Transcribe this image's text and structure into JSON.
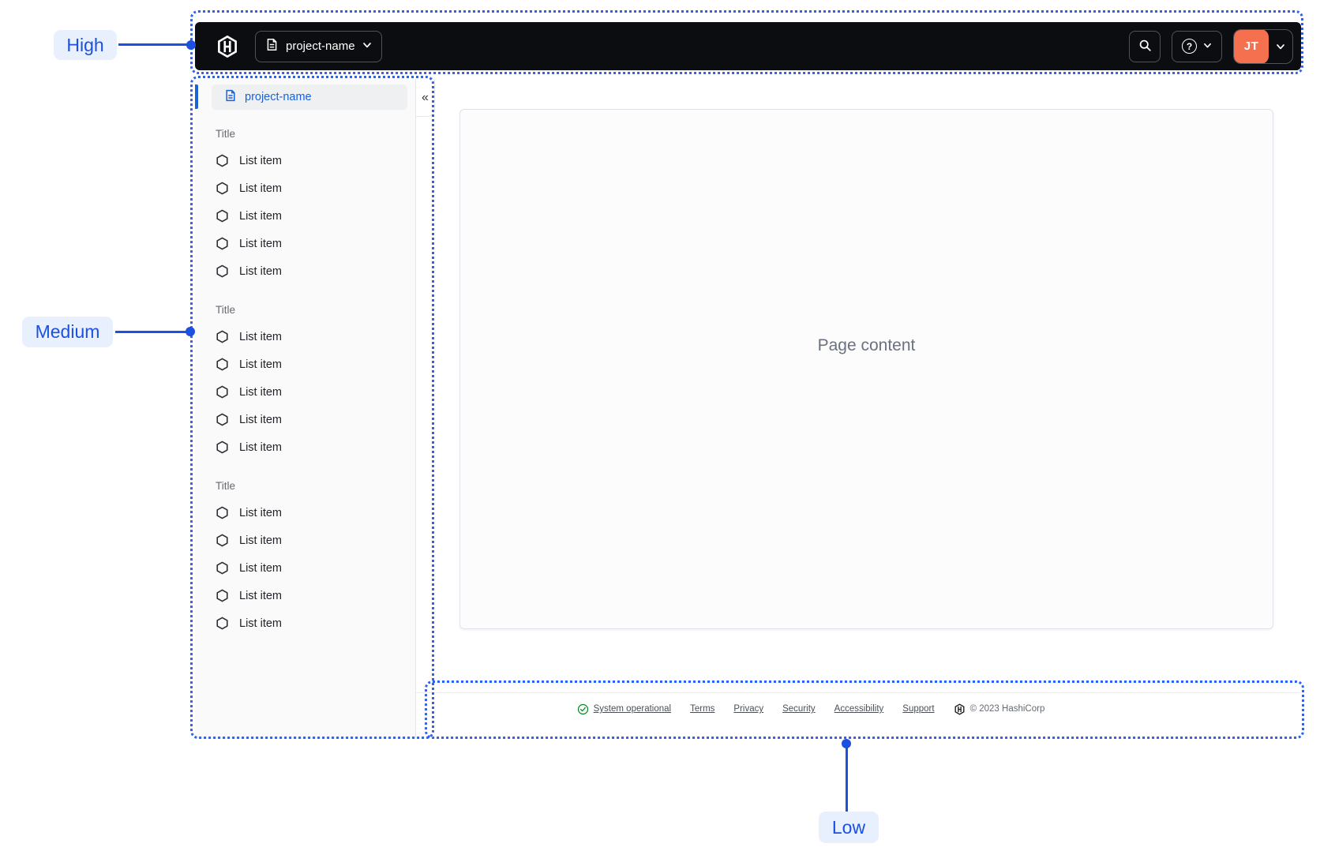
{
  "annotations": {
    "high": "High",
    "medium": "Medium",
    "low": "Low"
  },
  "navbar": {
    "project_switcher_label": "project-name",
    "help_glyph": "?",
    "avatar_initials": "JT"
  },
  "sidebar": {
    "project_label": "project-name",
    "collapse_glyph": "«",
    "sections": [
      {
        "title": "Title",
        "items": [
          "List item",
          "List item",
          "List item",
          "List item",
          "List item"
        ]
      },
      {
        "title": "Title",
        "items": [
          "List item",
          "List item",
          "List item",
          "List item",
          "List item"
        ]
      },
      {
        "title": "Title",
        "items": [
          "List item",
          "List item",
          "List item",
          "List item",
          "List item"
        ]
      }
    ]
  },
  "main": {
    "placeholder": "Page content"
  },
  "footer": {
    "status": "System operational",
    "links": [
      "Terms",
      "Privacy",
      "Security",
      "Accessibility",
      "Support"
    ],
    "copyright": "© 2023 HashiCorp"
  },
  "icons": {
    "hashicorp-logo-icon": "hexagon with H",
    "document-icon": "file with lines",
    "chevron-down-icon": "v",
    "search-icon": "magnifier",
    "help-icon": "? in circle",
    "hexagon-icon": "hexagon outline",
    "check-circle-icon": "check in circle",
    "collapse-icon": "«"
  },
  "colors": {
    "annotation_blue": "#1b50e0",
    "annotation_bg": "#e8effd",
    "navbar_bg": "#0c0d10",
    "avatar_orange": "#f4704f",
    "link_blue": "#1c61d8",
    "status_green": "#008a22",
    "sidebar_bg": "#fafafa"
  }
}
